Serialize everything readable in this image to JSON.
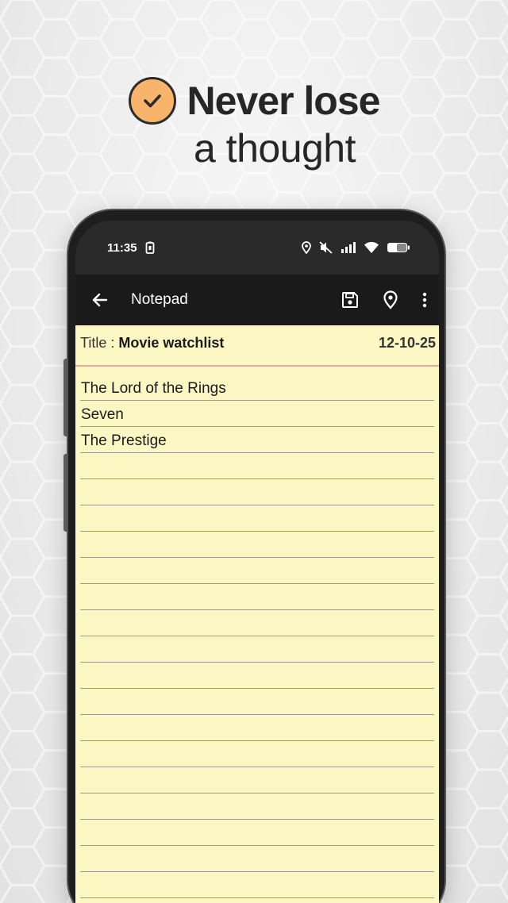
{
  "promo": {
    "headline_bold": "Never lose",
    "headline_light": "a thought",
    "badge_color": "#f7b46a"
  },
  "status_bar": {
    "time": "11:35",
    "icons": [
      "battery-saver-icon",
      "location-icon",
      "mute-icon",
      "signal-icon",
      "wifi-icon",
      "battery-icon"
    ]
  },
  "app_bar": {
    "title": "Notepad",
    "actions": [
      "back-arrow-icon",
      "save-icon",
      "location-pin-icon",
      "more-vert-icon"
    ]
  },
  "note": {
    "title_label": "Title :",
    "title_value": "Movie watchlist",
    "date": "12-10-25",
    "lines": [
      "The Lord of the Rings",
      "Seven",
      "The Prestige",
      "",
      "",
      "",
      "",
      "",
      "",
      "",
      "",
      "",
      "",
      "",
      "",
      "",
      "",
      "",
      "",
      "",
      ""
    ],
    "paper_color": "#fdf7c3"
  }
}
